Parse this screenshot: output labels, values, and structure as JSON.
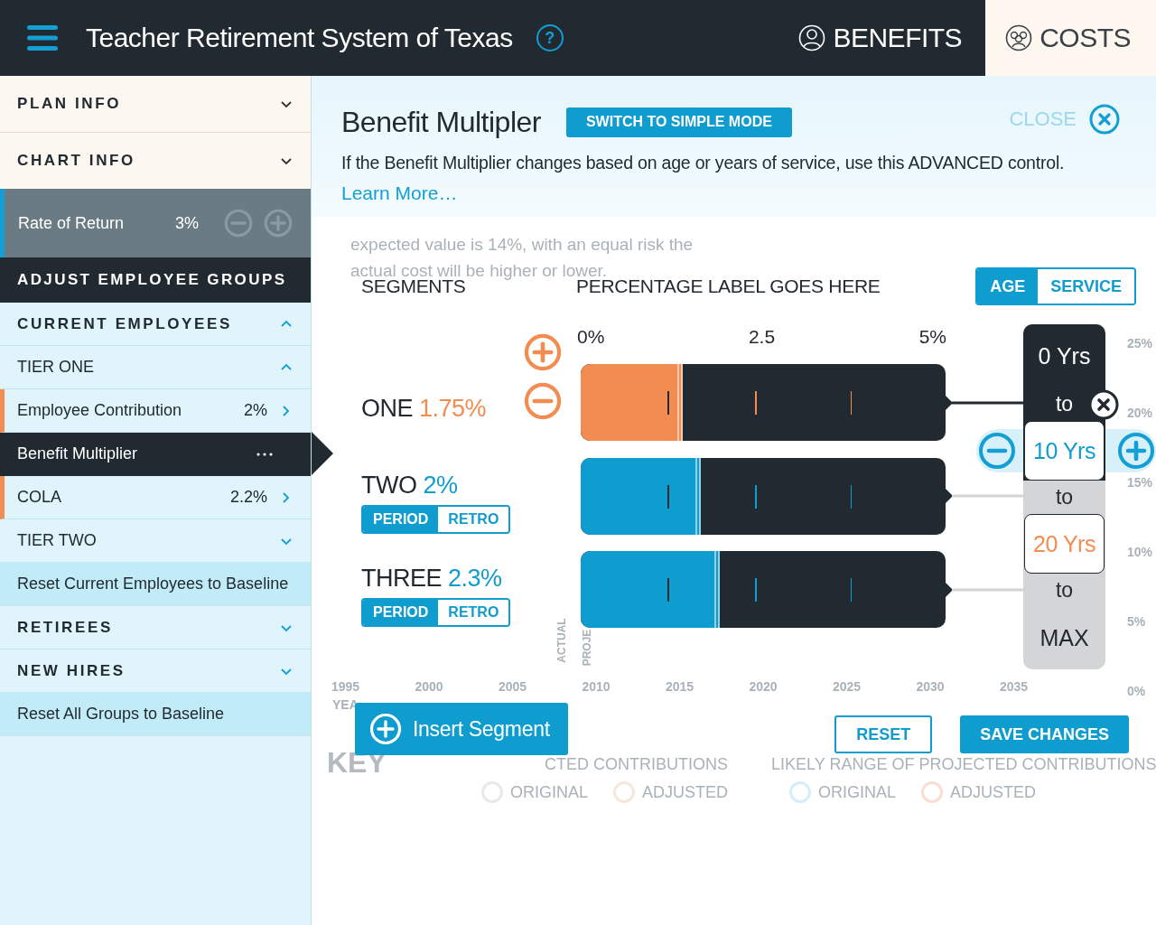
{
  "header": {
    "title": "Teacher Retirement System of Texas",
    "help": "?",
    "tabs": [
      {
        "label": "BENEFITS",
        "selected": false
      },
      {
        "label": "COSTS",
        "selected": true
      }
    ]
  },
  "sidebar": {
    "items": [
      {
        "kind": "panel",
        "label": "PLAN INFO",
        "expanded": false
      },
      {
        "kind": "panel",
        "label": "CHART INFO",
        "expanded": false
      },
      {
        "kind": "rate",
        "label": "Rate of Return",
        "value": "3%"
      },
      {
        "kind": "banner",
        "label": "ADJUST EMPLOYEE GROUPS"
      },
      {
        "kind": "group",
        "label": "CURRENT EMPLOYEES",
        "expanded": true
      },
      {
        "kind": "tier",
        "label": "TIER ONE",
        "expanded": true
      },
      {
        "kind": "setting",
        "label": "Employee Contribution",
        "value": "2%",
        "selected": false
      },
      {
        "kind": "setting",
        "label": "Benefit Multiplier",
        "selected": true
      },
      {
        "kind": "setting",
        "label": "COLA",
        "value": "2.2%",
        "selected": false
      },
      {
        "kind": "tier",
        "label": "TIER TWO",
        "expanded": false
      },
      {
        "kind": "reset",
        "label": "Reset Current Employees to Baseline"
      },
      {
        "kind": "group",
        "label": "RETIREES",
        "expanded": false
      },
      {
        "kind": "group",
        "label": "NEW HIRES",
        "expanded": false
      },
      {
        "kind": "reset",
        "label": "Reset All Groups to Baseline"
      }
    ]
  },
  "editor": {
    "title": "Benefit Multipler",
    "mode_button": "SWITCH TO SIMPLE MODE",
    "close": "CLOSE",
    "description": "If the Benefit Multiplier changes based on age or years of service, use this ADVANCED control.",
    "learn_more": "Learn More…",
    "segments_heading": "SEGMENTS",
    "percentage_heading": "PERCENTAGE LABEL GOES HERE",
    "basis_toggle": [
      {
        "label": "AGE",
        "selected": true
      },
      {
        "label": "SERVICE",
        "selected": false
      }
    ],
    "scale": [
      "0%",
      "2.5",
      "5%"
    ],
    "segments": [
      {
        "name": "ONE",
        "value": "1.75%",
        "color": "#f28c50",
        "selected": true,
        "level": 0.28
      },
      {
        "name": "TWO",
        "value": "2%",
        "color": "#0f9ccf",
        "selected": false,
        "level": 0.33,
        "modes": [
          {
            "label": "PERIOD",
            "selected": true
          },
          {
            "label": "RETRO",
            "selected": false
          }
        ]
      },
      {
        "name": "THREE",
        "value": "2.3%",
        "color": "#0f9ccf",
        "selected": false,
        "level": 0.38,
        "modes": [
          {
            "label": "PERIOD",
            "selected": true
          },
          {
            "label": "RETRO",
            "selected": false
          }
        ]
      }
    ],
    "ranges": [
      {
        "kind": "start",
        "label": "0 Yrs",
        "active": true
      },
      {
        "kind": "to",
        "label": "to",
        "active": true
      },
      {
        "kind": "boundary",
        "label": "10 Yrs",
        "selected": true,
        "color": "#0f9ccf"
      },
      {
        "kind": "to",
        "label": "to",
        "active": false
      },
      {
        "kind": "boundary",
        "label": "20 Yrs",
        "selected": false,
        "color": "#f28c50"
      },
      {
        "kind": "to",
        "label": "to",
        "active": false
      },
      {
        "kind": "end",
        "label": "MAX",
        "active": false
      }
    ],
    "insert_button": "Insert Segment",
    "reset_button": "RESET",
    "save_button": "SAVE CHANGES"
  },
  "background": {
    "note": [
      "expected value is 14%, with an equal risk the",
      "actual cost will be higher or lower."
    ],
    "y_ticks": [
      "25%",
      "20%",
      "15%",
      "10%",
      "5%",
      "0%"
    ],
    "x_ticks": [
      "1995",
      "2000",
      "2005",
      "2010",
      "2015",
      "2020",
      "2025",
      "2030",
      "2035"
    ],
    "x_axis_label": "YEA",
    "series_labels": [
      "ACTUAL",
      "PROJE"
    ],
    "key_title": "KEY",
    "legends": [
      {
        "title": "CTED CONTRIBUTIONS",
        "items": [
          {
            "label": "ORIGINAL",
            "color": "#e6eaec"
          },
          {
            "label": "ADJUSTED",
            "color": "#f7e6da"
          }
        ]
      },
      {
        "title": "LIKELY RANGE OF PROJECTED CONTRIBUTIONS",
        "items": [
          {
            "label": "ORIGINAL",
            "color": "#d6eef7"
          },
          {
            "label": "ADJUSTED",
            "color": "#f9ddd0"
          }
        ]
      }
    ]
  }
}
